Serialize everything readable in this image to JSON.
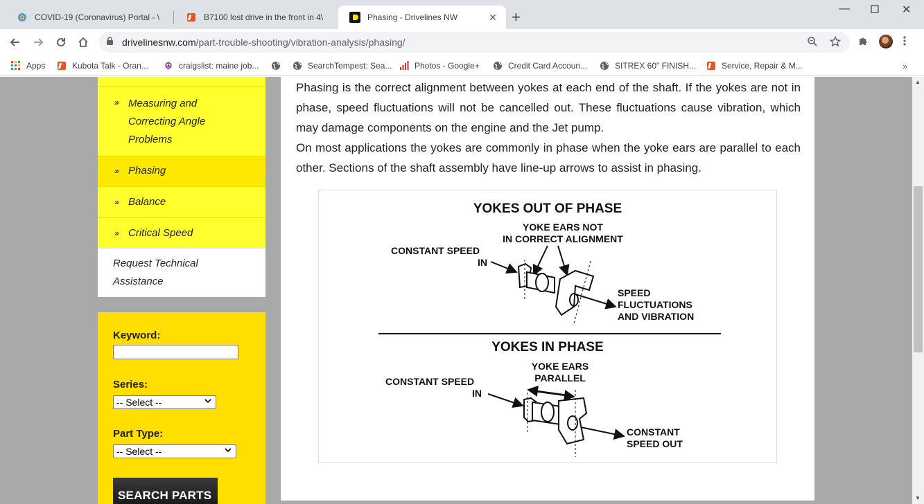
{
  "browser": {
    "tabs": [
      {
        "title": "COVID-19 (Coronavirus) Portal - \\",
        "icon": "covid-portal-icon"
      },
      {
        "title": "B7100 lost drive in the front in 4\\",
        "icon": "kubota-talk-icon"
      },
      {
        "title": "Phasing - Drivelines NW",
        "icon": "drivelines-icon",
        "active": true
      }
    ],
    "url_host": "drivelinesnw.com",
    "url_path": "/part-trouble-shooting/vibration-analysis/phasing/",
    "bookmarks": [
      {
        "label": "Apps",
        "icon": "apps-grid-icon"
      },
      {
        "label": "Kubota Talk - Oran...",
        "icon": "kubota-talk-icon"
      },
      {
        "label": "craigslist: maine job...",
        "icon": "peace-icon"
      },
      {
        "label": "",
        "icon": "globe-icon"
      },
      {
        "label": "SearchTempest: Sea...",
        "icon": "globe-icon"
      },
      {
        "label": "Photos - Google+",
        "icon": "signal-bars-icon"
      },
      {
        "label": "Credit Card Accoun...",
        "icon": "globe-icon"
      },
      {
        "label": "SITREX 60\" FINISH...",
        "icon": "globe-icon"
      },
      {
        "label": "Service, Repair & M...",
        "icon": "kubota-talk-icon"
      }
    ]
  },
  "sidebar": {
    "items": [
      {
        "label_lines": [
          "Measuring and",
          "Correcting Angle",
          "Problems"
        ],
        "active": false
      },
      {
        "label_lines": [
          "Phasing"
        ],
        "active": true
      },
      {
        "label_lines": [
          "Balance"
        ],
        "active": false
      },
      {
        "label_lines": [
          "Critical Speed"
        ],
        "active": false
      }
    ],
    "request_lines": [
      "Request Technical",
      "Assistance"
    ]
  },
  "search": {
    "keyword_label": "Keyword:",
    "series_label": "Series:",
    "series_value": "-- Select --",
    "part_type_label": "Part Type:",
    "part_type_value": "-- Select --",
    "button_label": "SEARCH PARTS"
  },
  "content": {
    "paragraph1": "Phasing is the correct alignment between yokes at each end of the shaft. If the yokes are not in phase, speed fluctuations will not be cancelled out. These fluctuations cause vibration, which may damage components on the engine and the Jet pump.",
    "paragraph2": "On most applications the yokes are commonly in phase when the yoke ears are parallel to each other. Sections of the shaft assembly have line-up arrows to assist in phasing."
  },
  "diagram": {
    "top_title": "YOKES OUT OF PHASE",
    "top_ears_1": "YOKE EARS NOT",
    "top_ears_2": "IN CORRECT ALIGNMENT",
    "top_in_1": "CONSTANT SPEED",
    "top_in_2": "IN",
    "top_out_1": "SPEED",
    "top_out_2": "FLUCTUATIONS",
    "top_out_3": "AND VIBRATION",
    "bottom_title": "YOKES IN PHASE",
    "bottom_ears_1": "YOKE EARS",
    "bottom_ears_2": "PARALLEL",
    "bottom_in_1": "CONSTANT SPEED",
    "bottom_in_2": "IN",
    "bottom_out_1": "CONSTANT",
    "bottom_out_2": "SPEED OUT"
  }
}
